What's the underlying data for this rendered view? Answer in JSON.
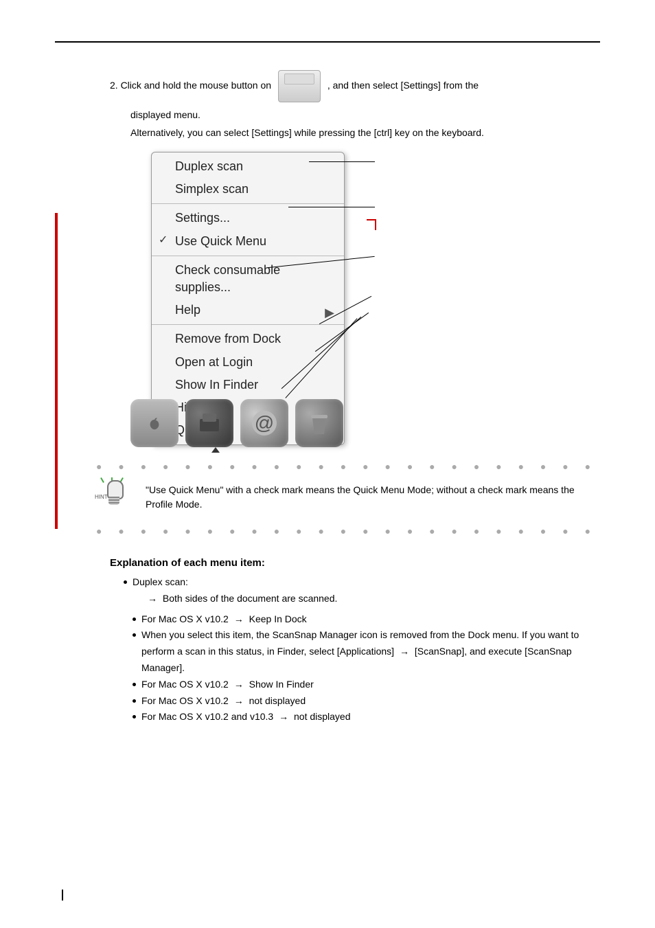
{
  "top_instruction_prefix": "2. Click and hold the mouse button on ",
  "top_instruction_suffix": ", and then select [Settings] from the",
  "sub_instruction_1": "displayed menu.",
  "sub_instruction_2": "Alternatively, you can select [Settings] while pressing the [ctrl] key on the keyboard.",
  "context_menu": {
    "duplex": "Duplex scan",
    "simplex": "Simplex scan",
    "settings": "Settings...",
    "use_quick_menu": "Use Quick Menu",
    "check_supplies": "Check consumable supplies...",
    "help": "Help",
    "remove_dock": "Remove from Dock",
    "open_login": "Open at Login",
    "show_finder": "Show In Finder",
    "hide": "Hide",
    "quit": "Quit"
  },
  "hint_label": "HINT",
  "hint_text": "\"Use Quick Menu\" with a check mark means the Quick Menu Mode; without a check mark means the Profile Mode.",
  "explain_heading": "Explanation of each menu item:",
  "menu_items": [
    {
      "title": "Duplex scan:",
      "desc_lines": [
        {
          "segments": [
            {
              "arrow": true
            },
            {
              "text": "Both sides of the document are scanned."
            }
          ]
        }
      ],
      "sub": [
        {
          "segments": [
            {
              "text": "For Mac OS X v10.2 "
            },
            {
              "arrow": true
            },
            {
              "text": " Keep In Dock"
            }
          ]
        },
        {
          "segments": [
            {
              "text": "When you select this item, the ScanSnap Manager icon is removed from the Dock menu.  If you want to perform a scan in this status, in Finder, select [Applications] "
            },
            {
              "arrow": true
            },
            {
              "text": " [ScanSnap], and execute [ScanSnap Manager]."
            }
          ]
        },
        {
          "segments": [
            {
              "text": "For Mac OS X v10.2 "
            },
            {
              "arrow": true
            },
            {
              "text": " Show In Finder"
            }
          ]
        },
        {
          "segments": [
            {
              "text": "For Mac OS X v10.2 "
            },
            {
              "arrow": true
            },
            {
              "text": " not displayed"
            }
          ]
        },
        {
          "segments": [
            {
              "text": "For Mac OS X v10.2 and v10.3 "
            },
            {
              "arrow": true
            },
            {
              "text": " not displayed"
            }
          ]
        }
      ]
    }
  ],
  "dots_text": "● ● ● ● ● ● ● ● ● ● ● ● ● ● ● ● ● ● ● ● ● ● ● ● ● ● ● ● ● ● ● ● ● ● ●"
}
